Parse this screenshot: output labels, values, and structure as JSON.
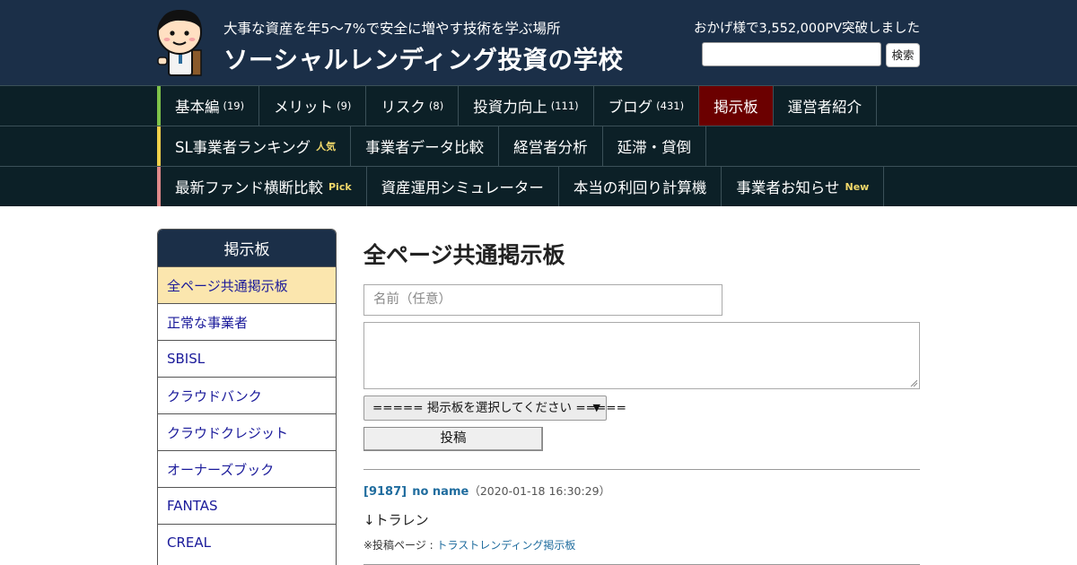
{
  "header": {
    "tagline": "大事な資産を年5～7%で安全に増やす技術を学ぶ場所",
    "title": "ソーシャルレンディング投資の学校",
    "pv_notice": "おかげ様で3,552,000PV突破しました",
    "search_value": "",
    "search_button": "検索",
    "mascot_icon": "cartoon-boy-with-book-icon"
  },
  "nav": {
    "rows": [
      {
        "accent": "#7ec24a",
        "items": [
          {
            "label": "基本編",
            "count": "(19)"
          },
          {
            "label": "メリット",
            "count": "(9)"
          },
          {
            "label": "リスク",
            "count": "(8)"
          },
          {
            "label": "投資力向上",
            "count": "(111)"
          },
          {
            "label": "ブログ",
            "count": "(431)"
          },
          {
            "label": "掲示板",
            "active": true
          },
          {
            "label": "運営者紹介"
          }
        ]
      },
      {
        "accent": "#f0d04a",
        "items": [
          {
            "label": "SL事業者ランキング",
            "badge": "人気"
          },
          {
            "label": "事業者データ比較"
          },
          {
            "label": "経営者分析"
          },
          {
            "label": "延滞・貸倒"
          }
        ]
      },
      {
        "accent": "#e08a8a",
        "items": [
          {
            "label": "最新ファンド横断比較",
            "badge": "Pick"
          },
          {
            "label": "資産運用シミュレーター"
          },
          {
            "label": "本当の利回り計算機"
          },
          {
            "label": "事業者お知らせ",
            "badge": "New"
          }
        ]
      }
    ]
  },
  "sidebar": {
    "title": "掲示板",
    "items": [
      {
        "label": "全ページ共通掲示板",
        "selected": true
      },
      {
        "label": "正常な事業者"
      },
      {
        "label": "SBISL"
      },
      {
        "label": "クラウドバンク"
      },
      {
        "label": "クラウドクレジット"
      },
      {
        "label": "オーナーズブック"
      },
      {
        "label": "FANTAS"
      },
      {
        "label": "CREAL"
      }
    ]
  },
  "main": {
    "title": "全ページ共通掲示板",
    "name_placeholder": "名前（任意）",
    "message_value": "",
    "select_value": "===== 掲示板を選択してください =====",
    "submit_label": "投稿",
    "posts": [
      {
        "id": "[9187]",
        "author": "no name",
        "date": "（2020-01-18 16:30:29）",
        "body": "↓トラレン",
        "source_prefix": "※投稿ページ : ",
        "source_link": "トラストレンディング掲示板"
      }
    ]
  },
  "colors": {
    "header_bg": "#1b2f48",
    "nav_bg": "#0c2027",
    "active_nav": "#6b0000",
    "sidebar_selected": "#fbe6ae",
    "link": "#1f6c9e",
    "sidebar_link": "#1a1a9a",
    "badge": "#f1d86a"
  }
}
